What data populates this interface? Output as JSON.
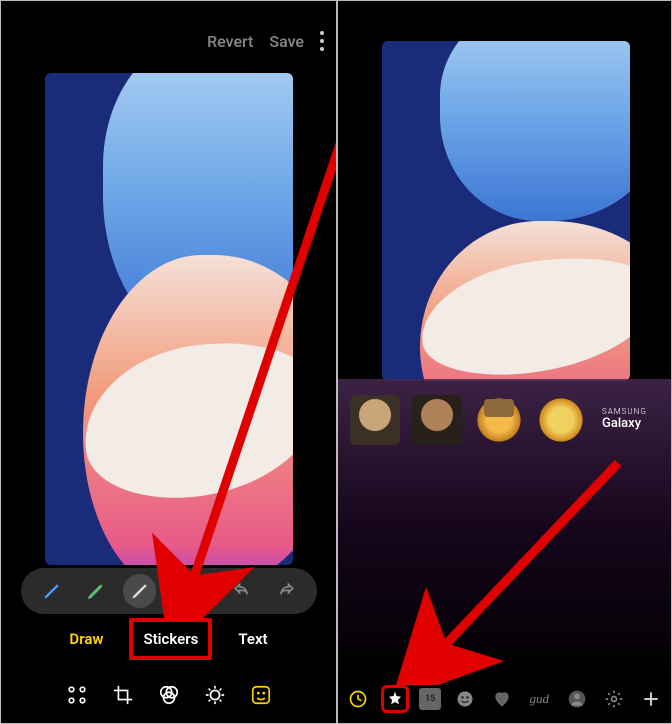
{
  "left": {
    "topbar": {
      "revert": "Revert",
      "save": "Save"
    },
    "tabs": {
      "draw": "Draw",
      "stickers": "Stickers",
      "text": "Text"
    }
  },
  "right": {
    "stickers": {
      "brand": "SAMSUNG",
      "model": "Galaxy"
    },
    "categories": {
      "date_number": "15"
    }
  }
}
